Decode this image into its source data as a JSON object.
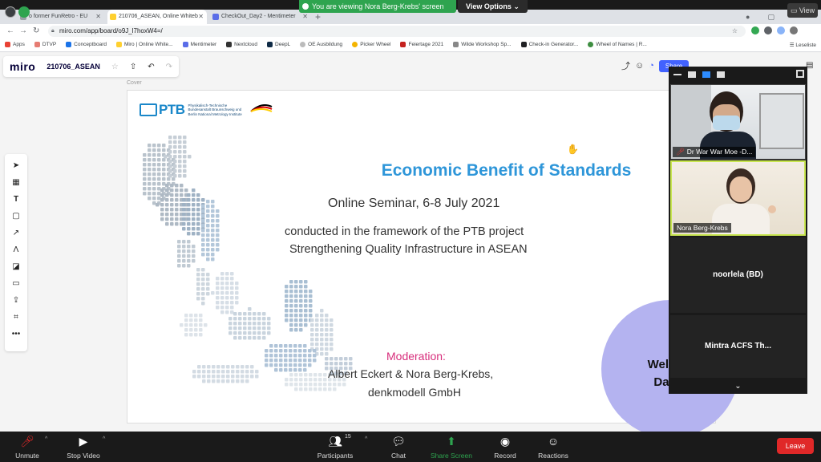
{
  "zoom": {
    "banner_text": "You are viewing Nora Berg-Krebs' screen",
    "view_options_label": "View Options",
    "view_button_label": "View",
    "bottom": {
      "unmute": "Unmute",
      "stop_video": "Stop Video",
      "participants": "Participants",
      "participants_count": "15",
      "chat": "Chat",
      "share_screen": "Share Screen",
      "record": "Record",
      "reactions": "Reactions",
      "leave": "Leave"
    },
    "gallery": {
      "tiles": [
        {
          "name": "Dr War War Moe -D..."
        },
        {
          "name": "Nora Berg-Krebs"
        },
        {
          "name": "noorlela (BD)"
        },
        {
          "name": "Mintra ACFS Th..."
        }
      ]
    },
    "colors": {
      "share_green": "#2ea44f",
      "leave_red": "#e02828",
      "accent_blue": "#2d8cff"
    }
  },
  "browser": {
    "tabs": [
      {
        "title": "o former FunRetro - EU"
      },
      {
        "title": "210706_ASEAN, Online Whiteb"
      },
      {
        "title": "CheckOut_Day2 - Mentimeter"
      }
    ],
    "url": "miro.com/app/board/o9J_l7hoxW4=/",
    "bookmarks": [
      "Apps",
      "DTVP",
      "Conceptboard",
      "Miro | Online White...",
      "Mentimeter",
      "Nextcloud",
      "DeepL",
      "OE Ausbildung",
      "Picker Wheel",
      "Feiertage 2021",
      "Wilde Workshop Sp...",
      "Check-in Generator...",
      "Wheel of Names | R..."
    ],
    "reading_list": "Leseliste"
  },
  "miro": {
    "logo": "miro",
    "board_name": "210706_ASEAN",
    "frame_label": "Cover",
    "share_label": "Share",
    "colors": {
      "share_blue": "#4262ff"
    }
  },
  "slide": {
    "ptb_logo": "PTB",
    "ptb_subtitle": "Physikalisch-Technische Bundesanstalt Braunschweig und Berlin National Metrology Institute",
    "title": "Economic Benefit of Standards",
    "subtitle": "Online Seminar, 6-8 July 2021",
    "line1": "conducted in the framework of the PTB project",
    "line2": "Strengthening Quality Infrastructure in ASEAN",
    "moderation_label": "Moderation:",
    "moderators": "Albert Eckert & Nora Berg-Krebs,",
    "company": "denkmodell GmbH",
    "colors": {
      "title_blue": "#2e96d9",
      "moderation_pink": "#d72d7b"
    }
  },
  "welcome": {
    "line1": "Welc",
    "line2": "Da"
  }
}
